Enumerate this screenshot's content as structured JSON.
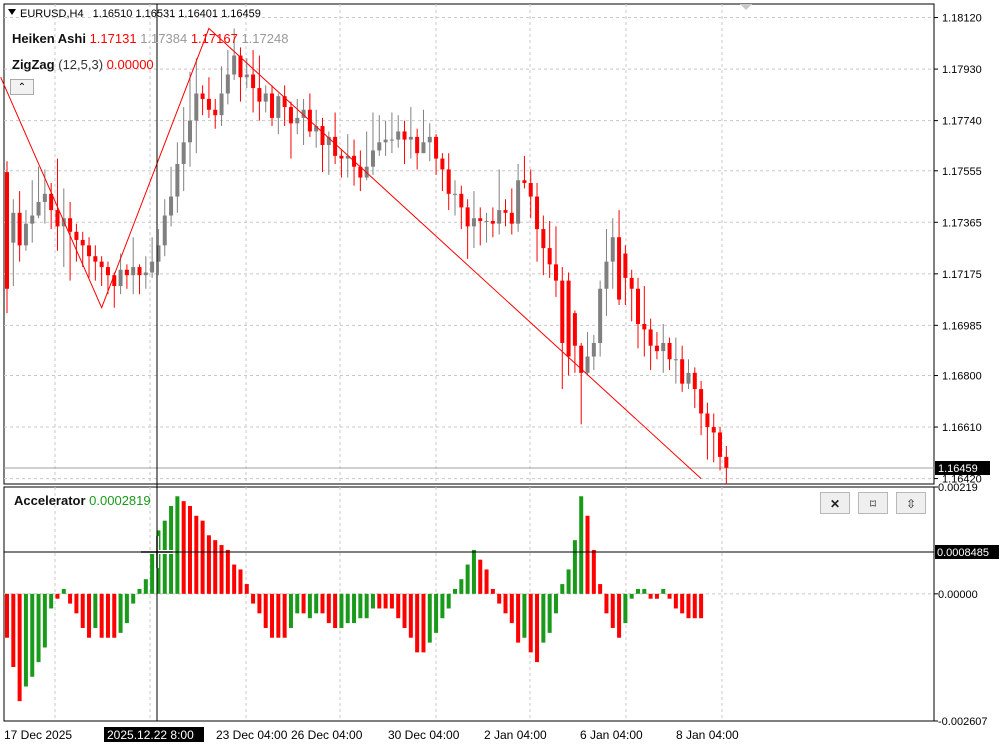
{
  "header": {
    "symbol": "EURUSD,H4",
    "ohlc": "1.16510 1.16531 1.16401 1.16459"
  },
  "indicators": {
    "heiken": {
      "name": "Heiken Ashi",
      "v1": "1.17131",
      "v2": "1.17384",
      "v3": "1.17167",
      "v4": "1.17248"
    },
    "zigzag": {
      "name": "ZigZag",
      "params": "(12,5,3)",
      "value": "0.00000"
    },
    "accelerator": {
      "name": "Accelerator",
      "value": "0.0002819"
    }
  },
  "buttons": {
    "close": "✕",
    "maximize": "⌑",
    "move": "⇳",
    "collapse": "⌃"
  },
  "colors": {
    "bull": "#808080",
    "bear": "#ff0000",
    "up": "#1a9a1a",
    "down": "#ff0000",
    "zigzag": "#ff0000"
  },
  "chart_data": {
    "type": "candlestick",
    "price_axis": {
      "ticks": [
        "1.18120",
        "1.17930",
        "1.17740",
        "1.17555",
        "1.17365",
        "1.17175",
        "1.16985",
        "1.16800",
        "1.16610",
        "1.16420"
      ],
      "current": "1.16459",
      "ylim": [
        1.164,
        1.1817
      ]
    },
    "time_axis": {
      "labels": [
        "17 Dec 2025",
        "23 Dec 04:00",
        "26 Dec 04:00",
        "30 Dec 04:00",
        "2 Jan 04:00",
        "6 Jan 04:00",
        "8 Jan 04:00"
      ],
      "crosshair_label": "2025.12.22 8:00"
    },
    "candles": [
      [
        1.1755,
        1.1712,
        1.1759,
        1.1703
      ],
      [
        1.1729,
        1.174,
        1.1745,
        1.1713
      ],
      [
        1.174,
        1.1728,
        1.1748,
        1.1722
      ],
      [
        1.1728,
        1.1736,
        1.1741,
        1.1726
      ],
      [
        1.1736,
        1.1739,
        1.1752,
        1.1729
      ],
      [
        1.1739,
        1.1744,
        1.1757,
        1.1738
      ],
      [
        1.1744,
        1.1747,
        1.1756,
        1.1736
      ],
      [
        1.1747,
        1.1741,
        1.1751,
        1.1734
      ],
      [
        1.1741,
        1.1735,
        1.176,
        1.1726
      ],
      [
        1.1735,
        1.1738,
        1.1749,
        1.172
      ],
      [
        1.1738,
        1.1733,
        1.1744,
        1.1715
      ],
      [
        1.1733,
        1.173,
        1.1736,
        1.1722
      ],
      [
        1.173,
        1.1728,
        1.1733,
        1.172
      ],
      [
        1.1728,
        1.1724,
        1.1731,
        1.1716
      ],
      [
        1.1724,
        1.1722,
        1.1728,
        1.1715
      ],
      [
        1.1722,
        1.172,
        1.1724,
        1.1713
      ],
      [
        1.172,
        1.1717,
        1.1722,
        1.171
      ],
      [
        1.1717,
        1.1713,
        1.1718,
        1.1705
      ],
      [
        1.1713,
        1.1719,
        1.1725,
        1.171
      ],
      [
        1.1719,
        1.1717,
        1.1721,
        1.1712
      ],
      [
        1.1717,
        1.172,
        1.1731,
        1.171
      ],
      [
        1.172,
        1.1717,
        1.1721,
        1.171
      ],
      [
        1.1717,
        1.1718,
        1.1724,
        1.1712
      ],
      [
        1.1718,
        1.1722,
        1.1731,
        1.1716
      ],
      [
        1.1722,
        1.1728,
        1.1734,
        1.1717
      ],
      [
        1.1728,
        1.1739,
        1.1745,
        1.1724
      ],
      [
        1.1739,
        1.1746,
        1.1757,
        1.1735
      ],
      [
        1.1746,
        1.1758,
        1.1766,
        1.174
      ],
      [
        1.1758,
        1.1766,
        1.1779,
        1.1748
      ],
      [
        1.1766,
        1.1774,
        1.1792,
        1.1757
      ],
      [
        1.1774,
        1.1784,
        1.1797,
        1.1762
      ],
      [
        1.1784,
        1.1782,
        1.1787,
        1.1776
      ],
      [
        1.1782,
        1.1778,
        1.179,
        1.1775
      ],
      [
        1.1778,
        1.1776,
        1.1782,
        1.1771
      ],
      [
        1.1776,
        1.1784,
        1.1794,
        1.1772
      ],
      [
        1.1784,
        1.1791,
        1.18,
        1.178
      ],
      [
        1.1791,
        1.1798,
        1.1808,
        1.1789
      ],
      [
        1.1798,
        1.179,
        1.1801,
        1.1781
      ],
      [
        1.179,
        1.1791,
        1.1797,
        1.1786
      ],
      [
        1.1791,
        1.1786,
        1.18,
        1.1777
      ],
      [
        1.1786,
        1.1781,
        1.1798,
        1.1774
      ],
      [
        1.1781,
        1.1784,
        1.1787,
        1.1777
      ],
      [
        1.1784,
        1.1775,
        1.1787,
        1.1772
      ],
      [
        1.1775,
        1.1783,
        1.1784,
        1.1769
      ],
      [
        1.1783,
        1.1779,
        1.1787,
        1.1772
      ],
      [
        1.1779,
        1.1773,
        1.1781,
        1.176
      ],
      [
        1.1773,
        1.1775,
        1.1782,
        1.1769
      ],
      [
        1.1775,
        1.1778,
        1.1782,
        1.1765
      ],
      [
        1.1778,
        1.177,
        1.1784,
        1.1768
      ],
      [
        1.177,
        1.1772,
        1.1778,
        1.1764
      ],
      [
        1.1772,
        1.1765,
        1.1775,
        1.1755
      ],
      [
        1.1765,
        1.1768,
        1.177,
        1.1754
      ],
      [
        1.1768,
        1.1761,
        1.1777,
        1.1758
      ],
      [
        1.1761,
        1.176,
        1.1763,
        1.1753
      ],
      [
        1.176,
        1.1761,
        1.1769,
        1.1753
      ],
      [
        1.1761,
        1.1757,
        1.1767,
        1.175
      ],
      [
        1.1757,
        1.1753,
        1.1763,
        1.1748
      ],
      [
        1.1753,
        1.1757,
        1.177,
        1.1752
      ],
      [
        1.1757,
        1.1763,
        1.1777,
        1.1754
      ],
      [
        1.1763,
        1.1766,
        1.1776,
        1.1761
      ],
      [
        1.1766,
        1.1767,
        1.1774,
        1.1761
      ],
      [
        1.1767,
        1.1767,
        1.1777,
        1.1762
      ],
      [
        1.1767,
        1.177,
        1.1776,
        1.1764
      ],
      [
        1.177,
        1.1767,
        1.1774,
        1.1758
      ],
      [
        1.1767,
        1.1768,
        1.1779,
        1.176
      ],
      [
        1.1768,
        1.1762,
        1.1771,
        1.1756
      ],
      [
        1.1762,
        1.1766,
        1.1778,
        1.1762
      ],
      [
        1.1766,
        1.1768,
        1.1773,
        1.1759
      ],
      [
        1.1768,
        1.176,
        1.1769,
        1.1754
      ],
      [
        1.176,
        1.1756,
        1.1762,
        1.1748
      ],
      [
        1.1756,
        1.1747,
        1.1762,
        1.1741
      ],
      [
        1.1747,
        1.1747,
        1.1752,
        1.1739
      ],
      [
        1.1747,
        1.1742,
        1.175,
        1.1734
      ],
      [
        1.1742,
        1.1735,
        1.1745,
        1.1723
      ],
      [
        1.1735,
        1.1738,
        1.1748,
        1.1727
      ],
      [
        1.1738,
        1.1737,
        1.1742,
        1.1728
      ],
      [
        1.1737,
        1.1737,
        1.174,
        1.1729
      ],
      [
        1.1737,
        1.1736,
        1.1742,
        1.1731
      ],
      [
        1.1736,
        1.1741,
        1.1756,
        1.1732
      ],
      [
        1.1741,
        1.174,
        1.1745,
        1.1735
      ],
      [
        1.174,
        1.1736,
        1.1749,
        1.1732
      ],
      [
        1.1736,
        1.1752,
        1.1758,
        1.1733
      ],
      [
        1.1752,
        1.1751,
        1.1761,
        1.1749
      ],
      [
        1.1751,
        1.1746,
        1.1756,
        1.1738
      ],
      [
        1.1746,
        1.1734,
        1.1751,
        1.1722
      ],
      [
        1.1734,
        1.1727,
        1.1739,
        1.1717
      ],
      [
        1.1727,
        1.1721,
        1.1737,
        1.1716
      ],
      [
        1.1721,
        1.1715,
        1.1735,
        1.1709
      ],
      [
        1.1715,
        1.1692,
        1.172,
        1.1675
      ],
      [
        1.1715,
        1.1687,
        1.1718,
        1.168
      ],
      [
        1.1703,
        1.1691,
        1.1704,
        1.1681
      ],
      [
        1.1691,
        1.1681,
        1.1692,
        1.1662
      ],
      [
        1.1681,
        1.1687,
        1.1696,
        1.168
      ],
      [
        1.1687,
        1.1692,
        1.1695,
        1.1682
      ],
      [
        1.1692,
        1.1712,
        1.1715,
        1.1687
      ],
      [
        1.1712,
        1.1722,
        1.1734,
        1.1702
      ],
      [
        1.1722,
        1.1731,
        1.1738,
        1.1712
      ],
      [
        1.1731,
        1.1708,
        1.1741,
        1.1706
      ],
      [
        1.1725,
        1.1716,
        1.1728,
        1.1706
      ],
      [
        1.1716,
        1.1712,
        1.1719,
        1.17
      ],
      [
        1.1712,
        1.1699,
        1.1716,
        1.169
      ],
      [
        1.1699,
        1.1697,
        1.1713,
        1.1687
      ],
      [
        1.1697,
        1.1691,
        1.1701,
        1.1682
      ],
      [
        1.1691,
        1.1689,
        1.1696,
        1.1686
      ],
      [
        1.1689,
        1.1692,
        1.1699,
        1.1681
      ],
      [
        1.1692,
        1.1686,
        1.1694,
        1.1682
      ],
      [
        1.1686,
        1.1686,
        1.1694,
        1.1677
      ],
      [
        1.1686,
        1.1677,
        1.1691,
        1.1674
      ],
      [
        1.1677,
        1.1681,
        1.1686,
        1.1675
      ],
      [
        1.1681,
        1.1675,
        1.1683,
        1.1668
      ],
      [
        1.1675,
        1.1666,
        1.1678,
        1.1658
      ],
      [
        1.1666,
        1.1661,
        1.167,
        1.1649
      ],
      [
        1.1661,
        1.1659,
        1.1666,
        1.1648
      ],
      [
        1.1659,
        1.165,
        1.1661,
        1.1645
      ],
      [
        1.165,
        1.1646,
        1.1654,
        1.164
      ]
    ],
    "zigzag_points": [
      [
        -1,
        1.179
      ],
      [
        15,
        1.1705
      ],
      [
        32,
        1.1808
      ],
      [
        110,
        1.1642
      ]
    ],
    "accelerator": {
      "ylim": [
        -0.002607,
        0.00219
      ],
      "ticks": [
        "0.00219",
        "0.00000",
        "-0.002607"
      ],
      "crosshair_value": "0.0008485",
      "values": [
        -0.0009,
        -0.0015,
        -0.0022,
        -0.0019,
        -0.0017,
        -0.0014,
        -0.0011,
        -0.0003,
        -0.0001,
        0.0001,
        -0.0002,
        -0.0004,
        -0.0007,
        -0.0009,
        -0.0007,
        -0.0009,
        -0.0009,
        -0.0009,
        -0.0008,
        -0.0006,
        -0.0002,
        0.0001,
        0.0003,
        0.0009,
        0.0013,
        0.0015,
        0.0018,
        0.002,
        0.0019,
        0.0018,
        0.0016,
        0.0015,
        0.0012,
        0.0011,
        0.001,
        0.0009,
        0.0006,
        0.0005,
        0.0002,
        -0.0002,
        -0.0004,
        -0.0007,
        -0.0009,
        -0.0009,
        -0.0009,
        -0.0007,
        -0.0004,
        -0.0004,
        -0.0005,
        -0.0004,
        -0.0004,
        -0.0006,
        -0.0007,
        -0.0007,
        -0.0006,
        -0.0006,
        -0.0005,
        -0.0005,
        -0.0003,
        -0.0003,
        -0.0003,
        -0.0003,
        -0.0005,
        -0.0007,
        -0.0009,
        -0.0012,
        -0.0012,
        -0.001,
        -0.0008,
        -0.0005,
        -0.0003,
        0.0001,
        0.0003,
        0.0006,
        0.0009,
        0.0007,
        0.0005,
        0.0001,
        -0.0002,
        -0.0004,
        -0.0006,
        -0.001,
        -0.0009,
        -0.0012,
        -0.0014,
        -0.001,
        -0.0008,
        -0.0004,
        0.0002,
        0.0005,
        0.0011,
        0.002,
        0.0016,
        0.0009,
        0.0002,
        -0.0004,
        -0.0007,
        -0.0009,
        -0.0006,
        -0.0001,
        0.0001,
        0.0001,
        -0.0001,
        -0.0001,
        0.0001,
        -0.0001,
        -0.0003,
        -0.0004,
        -0.0005,
        -0.0005,
        -0.0005
      ],
      "colors": [
        "r",
        "r",
        "r",
        "g",
        "g",
        "g",
        "g",
        "g",
        "r",
        "g",
        "r",
        "r",
        "r",
        "r",
        "g",
        "r",
        "r",
        "r",
        "g",
        "g",
        "g",
        "g",
        "g",
        "g",
        "g",
        "g",
        "g",
        "g",
        "r",
        "r",
        "r",
        "r",
        "r",
        "r",
        "r",
        "r",
        "r",
        "r",
        "r",
        "r",
        "r",
        "r",
        "r",
        "r",
        "r",
        "g",
        "g",
        "r",
        "g",
        "g",
        "r",
        "r",
        "r",
        "g",
        "g",
        "g",
        "g",
        "g",
        "g",
        "r",
        "r",
        "r",
        "r",
        "r",
        "r",
        "r",
        "r",
        "g",
        "g",
        "g",
        "g",
        "g",
        "g",
        "g",
        "g",
        "r",
        "r",
        "r",
        "r",
        "r",
        "r",
        "r",
        "g",
        "r",
        "r",
        "g",
        "g",
        "g",
        "g",
        "g",
        "g",
        "g",
        "r",
        "r",
        "r",
        "r",
        "r",
        "r",
        "g",
        "g",
        "g",
        "g",
        "r",
        "r",
        "g",
        "r",
        "r",
        "r",
        "r",
        "r",
        "r",
        "r"
      ]
    }
  }
}
